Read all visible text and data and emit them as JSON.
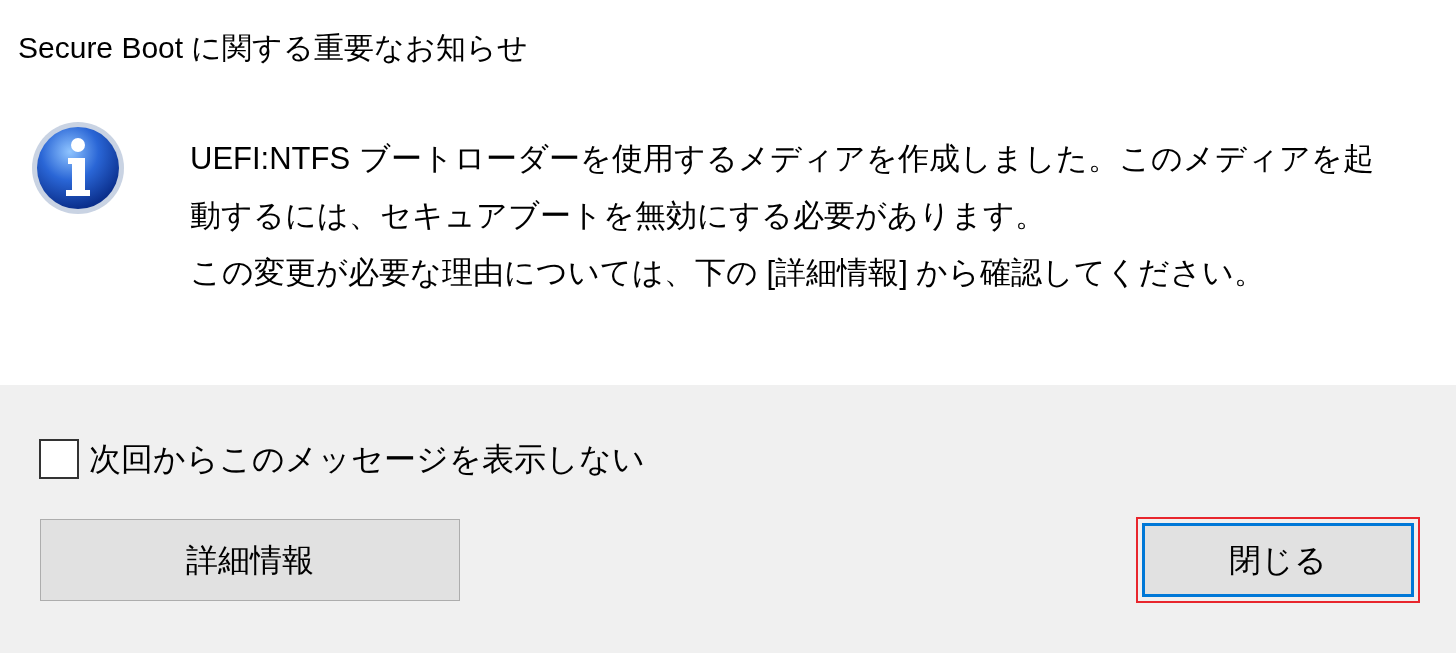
{
  "dialog": {
    "title": "Secure Boot に関する重要なお知らせ",
    "message_lines": [
      "UEFI:NTFS ブートローダーを使用するメディアを作成しました。このメディアを起",
      "動するには、セキュアブートを無効にする必要があります。",
      "この変更が必要な理由については、下の [詳細情報] から確認してください。"
    ],
    "checkbox": {
      "label": "次回からこのメッセージを表示しない",
      "checked": false
    },
    "buttons": [
      {
        "label": "詳細情報",
        "focused": false,
        "highlighted": false
      },
      {
        "label": "閉じる",
        "focused": true,
        "highlighted": true
      }
    ]
  }
}
